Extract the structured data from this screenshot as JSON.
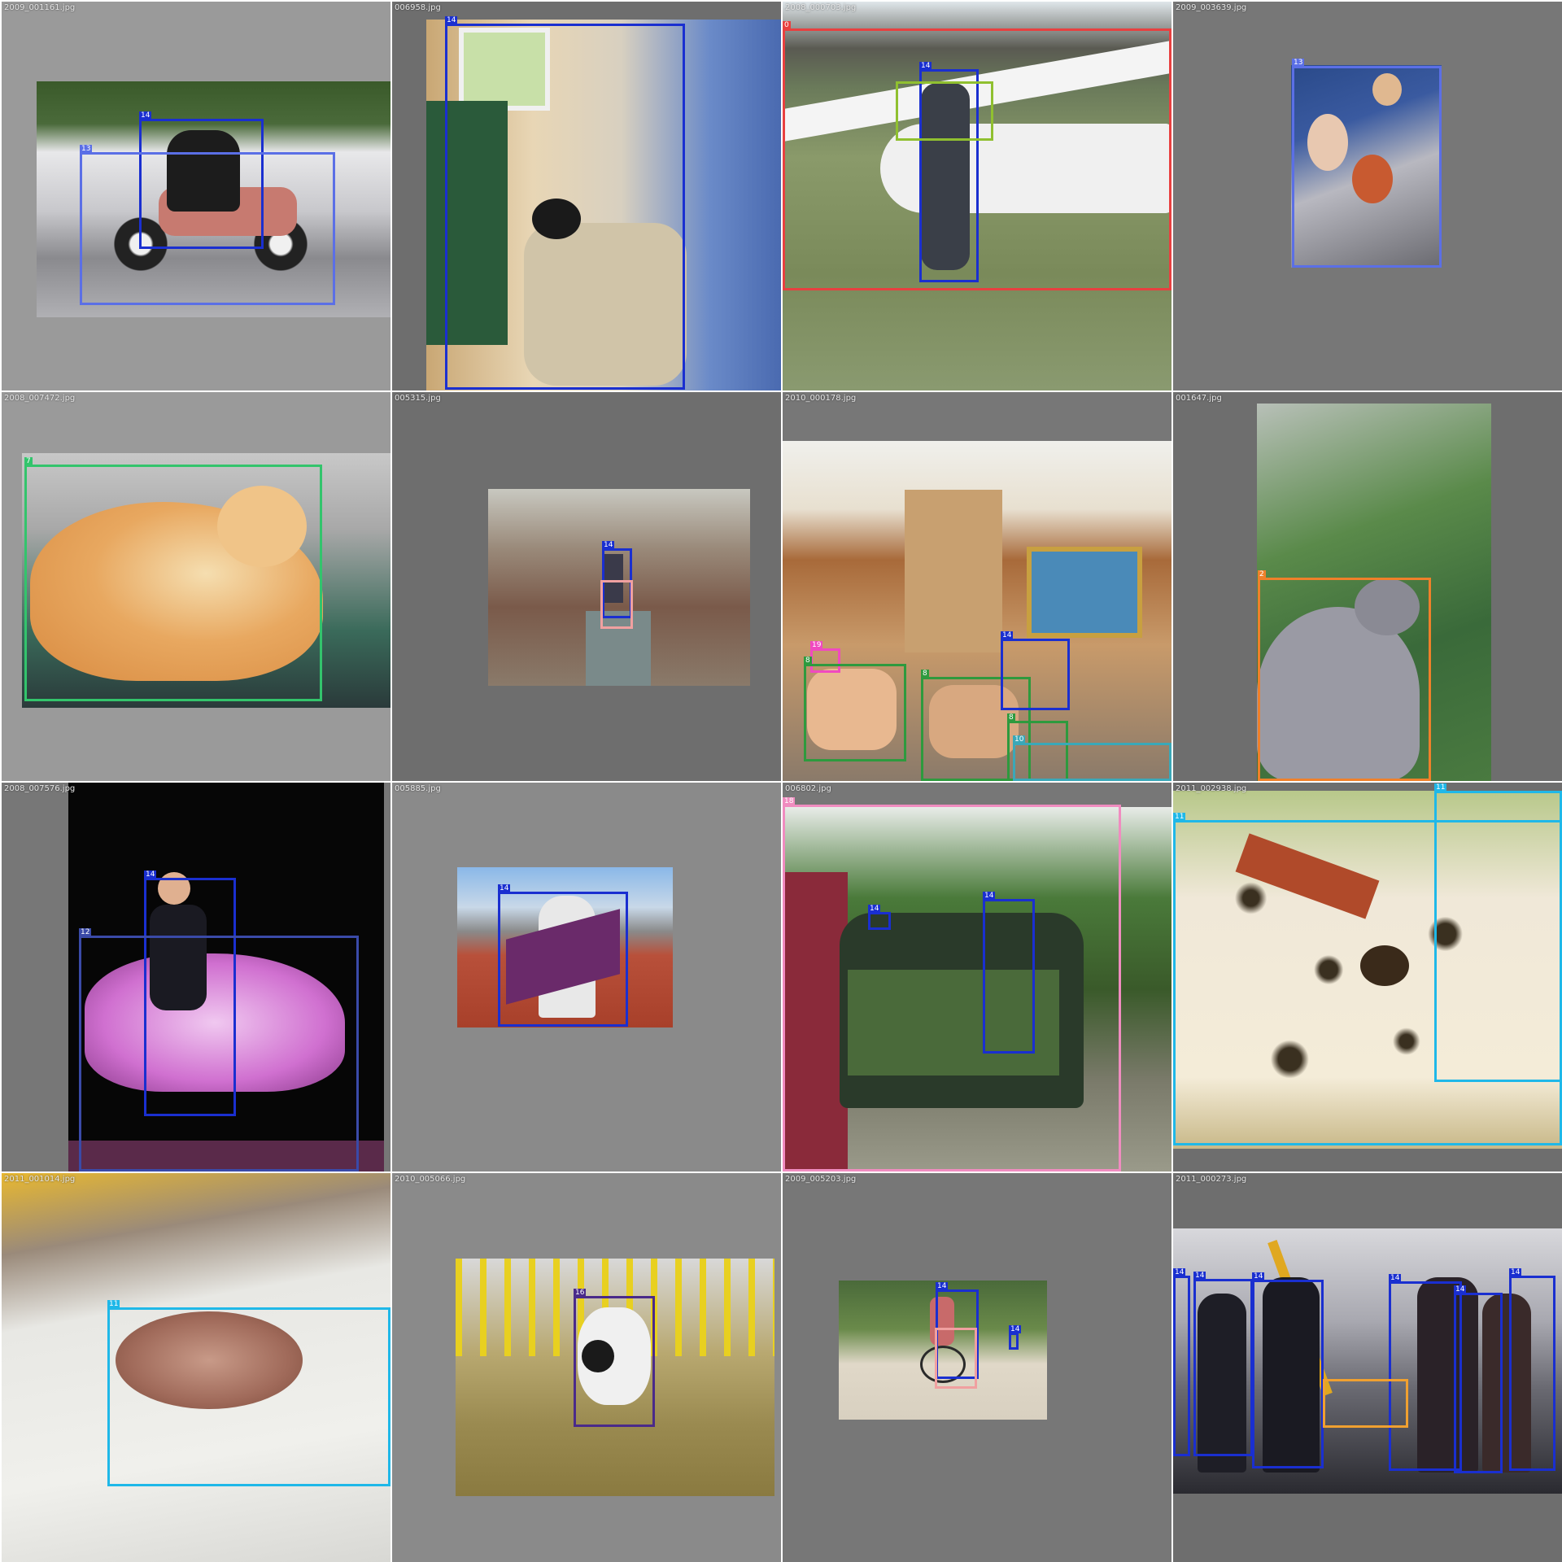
{
  "colors": {
    "person": "#1a2fd0",
    "motorbike": "#5b6fe6",
    "dog": "#1fb8e8",
    "cat": "#33c46c",
    "chair": "#2e9a3e",
    "aeroplane": "#e84040",
    "horse": "#3a4aa8",
    "bird": "#f0802a",
    "bicycle": "#f0a0a0",
    "sofa": "#3aa8b8",
    "train": "#f08cc0",
    "sheep": "#4a2a8a",
    "boat": "#f0a030",
    "bottle": "#90c030",
    "tvmonitor": "#f04ac0"
  },
  "tiles": [
    {
      "file": "2009_001161.jpg",
      "boxes": [
        {
          "label": "14",
          "color_key": "person"
        },
        {
          "label": "13",
          "color_key": "motorbike"
        }
      ]
    },
    {
      "file": "006958.jpg",
      "boxes": [
        {
          "label": "14",
          "color_key": "person"
        }
      ]
    },
    {
      "file": "2008_000703.jpg",
      "boxes": [
        {
          "label": "0",
          "color_key": "aeroplane"
        },
        {
          "label": "14",
          "color_key": "person"
        },
        {
          "label": "",
          "color_key": "bottle"
        }
      ]
    },
    {
      "file": "2009_003639.jpg",
      "boxes": [
        {
          "label": "13",
          "color_key": "motorbike"
        }
      ]
    },
    {
      "file": "2008_007472.jpg",
      "boxes": [
        {
          "label": "7",
          "color_key": "cat"
        }
      ]
    },
    {
      "file": "005315.jpg",
      "boxes": [
        {
          "label": "14",
          "color_key": "person"
        },
        {
          "label": "",
          "color_key": "bicycle"
        }
      ]
    },
    {
      "file": "2010_000178.jpg",
      "boxes": [
        {
          "label": "19",
          "color_key": "tvmonitor"
        },
        {
          "label": "8",
          "color_key": "chair"
        },
        {
          "label": "8",
          "color_key": "chair"
        },
        {
          "label": "14",
          "color_key": "person"
        },
        {
          "label": "8",
          "color_key": "chair"
        },
        {
          "label": "10",
          "color_key": "sofa"
        }
      ]
    },
    {
      "file": "001647.jpg",
      "boxes": [
        {
          "label": "2",
          "color_key": "bird"
        }
      ]
    },
    {
      "file": "2008_007576.jpg",
      "boxes": [
        {
          "label": "14",
          "color_key": "person"
        },
        {
          "label": "12",
          "color_key": "horse"
        }
      ]
    },
    {
      "file": "005885.jpg",
      "boxes": [
        {
          "label": "14",
          "color_key": "person"
        }
      ]
    },
    {
      "file": "006802.jpg",
      "boxes": [
        {
          "label": "18",
          "color_key": "train"
        },
        {
          "label": "14",
          "color_key": "person"
        },
        {
          "label": "14",
          "color_key": "person"
        }
      ]
    },
    {
      "file": "2011_002938.jpg",
      "boxes": [
        {
          "label": "11",
          "color_key": "dog"
        },
        {
          "label": "11",
          "color_key": "dog"
        }
      ]
    },
    {
      "file": "2011_001014.jpg",
      "boxes": [
        {
          "label": "11",
          "color_key": "dog"
        }
      ]
    },
    {
      "file": "2010_005066.jpg",
      "boxes": [
        {
          "label": "16",
          "color_key": "sheep"
        }
      ]
    },
    {
      "file": "2009_005203.jpg",
      "boxes": [
        {
          "label": "14",
          "color_key": "person"
        },
        {
          "label": "14",
          "color_key": "person"
        },
        {
          "label": "",
          "color_key": "bicycle"
        }
      ]
    },
    {
      "file": "2011_000273.jpg",
      "boxes": [
        {
          "label": "14",
          "color_key": "person"
        },
        {
          "label": "14",
          "color_key": "person"
        },
        {
          "label": "14",
          "color_key": "person"
        },
        {
          "label": "14",
          "color_key": "person"
        },
        {
          "label": "14",
          "color_key": "person"
        },
        {
          "label": "14",
          "color_key": "person"
        },
        {
          "label": "",
          "color_key": "boat"
        }
      ]
    }
  ]
}
